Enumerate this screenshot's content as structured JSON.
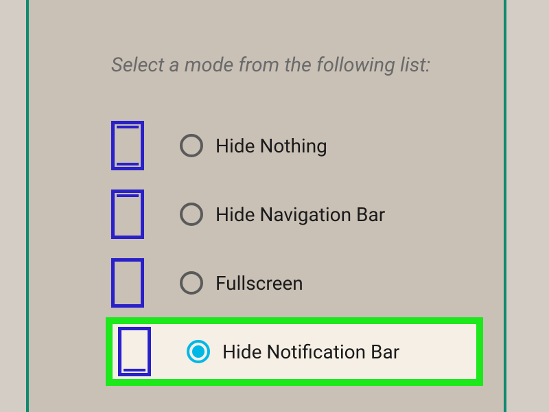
{
  "instruction": "Select a mode from the following list:",
  "options": [
    {
      "label": "Hide Nothing",
      "selected": false,
      "highlighted": false,
      "showTopBar": true,
      "showBottomBar": true
    },
    {
      "label": "Hide Navigation Bar",
      "selected": false,
      "highlighted": false,
      "showTopBar": true,
      "showBottomBar": false
    },
    {
      "label": "Fullscreen",
      "selected": false,
      "highlighted": false,
      "showTopBar": false,
      "showBottomBar": false
    },
    {
      "label": "Hide Notification Bar",
      "selected": true,
      "highlighted": true,
      "showTopBar": false,
      "showBottomBar": true
    }
  ]
}
